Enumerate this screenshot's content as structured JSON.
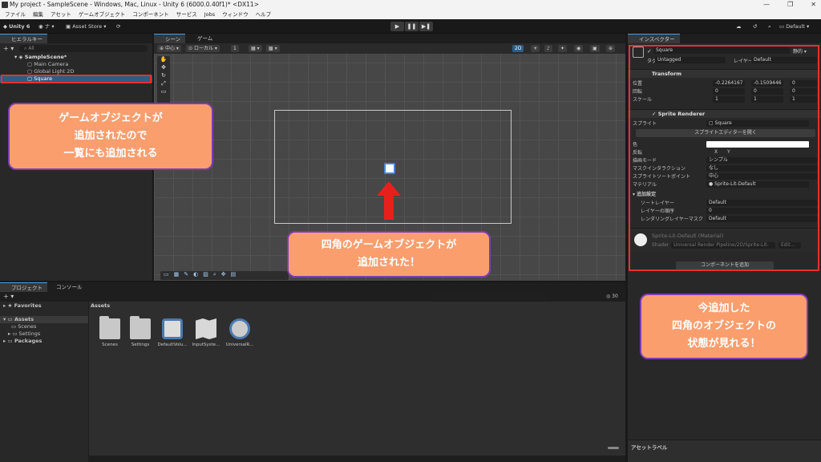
{
  "window": {
    "title": "My project - SampleScene - Windows, Mac, Linux - Unity 6 (6000.0.40f1)* <DX11>"
  },
  "menu": [
    "ファイル",
    "編集",
    "アセット",
    "ゲームオブジェクト",
    "コンポーネント",
    "サービス",
    "Jobs",
    "ウィンドウ",
    "ヘルプ"
  ],
  "toolbar": {
    "unity_label": "Unity 6",
    "account": "ナ",
    "asset_store": "Asset Store",
    "layout": "Default"
  },
  "hierarchy": {
    "tab": "ヒエラルキー",
    "search": "All",
    "scene": "SampleScene*",
    "items": [
      "Main Camera",
      "Global Light 2D",
      "Square"
    ]
  },
  "scene_view": {
    "tabs": [
      "シーン",
      "ゲーム"
    ],
    "pivot": "中心",
    "space": "ローカル",
    "grid_value": "1",
    "mode_2d": "2D"
  },
  "inspector": {
    "tab": "インスペクター",
    "object_name": "Square",
    "static_label": "静的",
    "tag_label": "タグ",
    "tag_value": "Untagged",
    "layer_label": "レイヤー",
    "layer_value": "Default",
    "transform": {
      "title": "Transform",
      "position_label": "位置",
      "rotation_label": "回転",
      "scale_label": "スケール",
      "pos": [
        "-0.2264167",
        "-0.1509446",
        "0"
      ],
      "rot": [
        "0",
        "0",
        "0"
      ],
      "scale": [
        "1",
        "1",
        "1"
      ]
    },
    "sprite_renderer": {
      "title": "Sprite Renderer",
      "sprite_label": "スプライト",
      "sprite_value": "Square",
      "open_editor": "スプライトエディターを開く",
      "color_label": "色",
      "flip_label": "反転",
      "flip_x": "X",
      "flip_y": "Y",
      "draw_mode_label": "描画モード",
      "draw_mode_value": "シンプル",
      "mask_label": "マスクインタラクション",
      "mask_value": "なし",
      "sort_point_label": "スプライトソートポイント",
      "sort_point_value": "中心",
      "material_label": "マテリアル",
      "material_value": "Sprite-Lit-Default",
      "additional_label": "追加設定",
      "sorting_layer_label": "ソートレイヤー",
      "sorting_layer_value": "Default",
      "order_label": "レイヤーの順序",
      "order_value": "0",
      "rendering_mask_label": "レンダリングレイヤーマスク",
      "rendering_mask_value": "Default"
    },
    "material": {
      "name": "Sprite-Lit-Default (Material)",
      "shader_label": "Shader",
      "shader_value": "Universal Render Pipeline/2D/Sprite-Lit-",
      "edit": "Edit..."
    },
    "add_component": "コンポーネントを追加",
    "asset_label": "アセットラベル"
  },
  "project": {
    "tabs": [
      "プロジェクト",
      "コンソール"
    ],
    "favorites": "Favorites",
    "assets": "Assets",
    "tree": [
      "Scenes",
      "Settings"
    ],
    "packages": "Packages",
    "breadcrumb": "Assets",
    "count": "30",
    "files": [
      "Scenes",
      "Settings",
      "DefaultVolu...",
      "InputSyste...",
      "UniversalR..."
    ]
  },
  "callouts": {
    "hierarchy": [
      "ゲームオブジェクトが",
      "追加されたので",
      "一覧にも追加される"
    ],
    "scene": [
      "四角のゲームオブジェクトが",
      "追加された！"
    ],
    "inspector": [
      "今追加した",
      "四角のオブジェクトの",
      "状態が見れる！"
    ]
  },
  "colors": {
    "accent": "#4aa0e8",
    "callout_fill": "#fa9e6e",
    "callout_border": "#7b3fb0",
    "highlight": "#e53030"
  }
}
